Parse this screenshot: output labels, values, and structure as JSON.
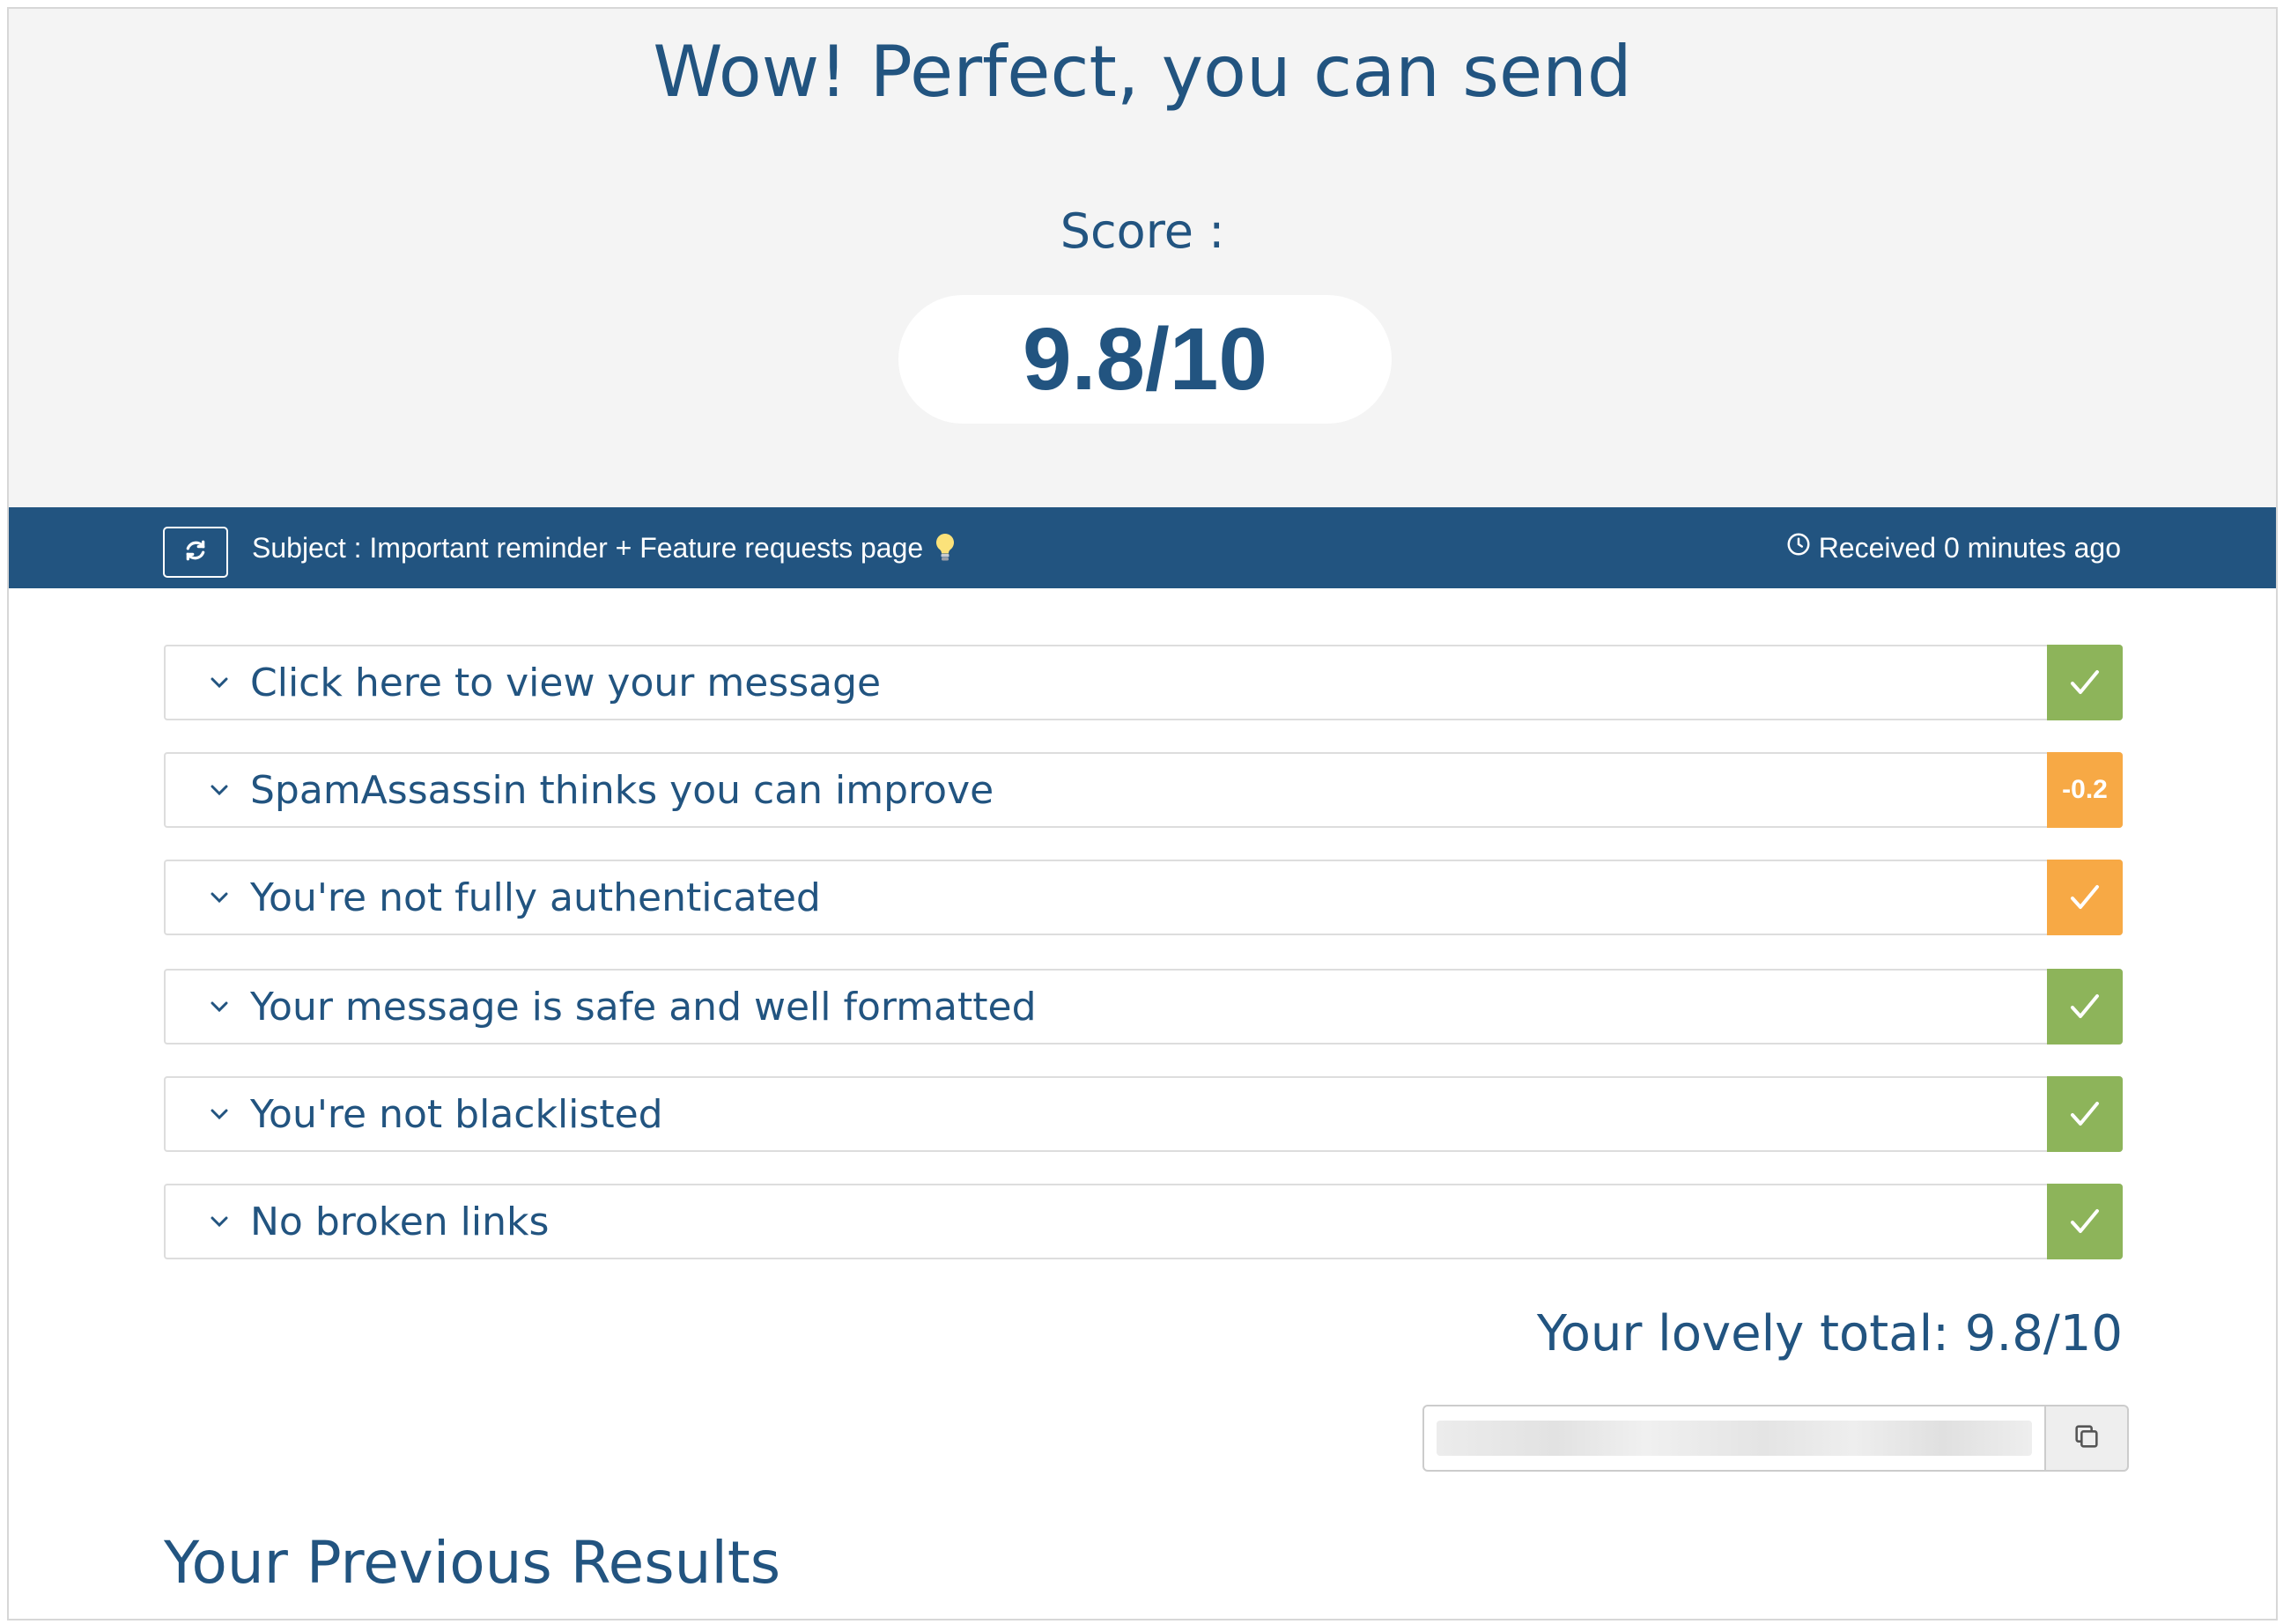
{
  "hero": {
    "title": "Wow! Perfect, you can send",
    "score_label": "Score :",
    "score_value": "9.8/10"
  },
  "subject_bar": {
    "subject": "Subject : Important reminder + Feature requests page",
    "received": "Received 0 minutes ago",
    "refresh_icon": "refresh-icon",
    "bulb_icon": "lightbulb-icon",
    "clock_icon": "clock-icon"
  },
  "checks": [
    {
      "title": "Click here to view your message",
      "badge": "✓",
      "status": "pass",
      "color": "#8db45a"
    },
    {
      "title": "SpamAssassin thinks you can improve",
      "badge": "-0.2",
      "status": "warn",
      "color": "#f7a945"
    },
    {
      "title": "You're not fully authenticated",
      "badge": "✓",
      "status": "warn",
      "color": "#f7a945"
    },
    {
      "title": "Your message is safe and well formatted",
      "badge": "✓",
      "status": "pass",
      "color": "#8db45a"
    },
    {
      "title": "You're not blacklisted",
      "badge": "✓",
      "status": "pass",
      "color": "#8db45a"
    },
    {
      "title": "No broken links",
      "badge": "✓",
      "status": "pass",
      "color": "#8db45a"
    }
  ],
  "total": "Your lovely total: 9.8/10",
  "share": {
    "copy_icon": "copy-icon"
  },
  "previous_title": "Your Previous Results",
  "colors": {
    "primary": "#225480",
    "pass": "#8db45a",
    "warn": "#f7a945",
    "hero_bg": "#f4f4f4"
  }
}
